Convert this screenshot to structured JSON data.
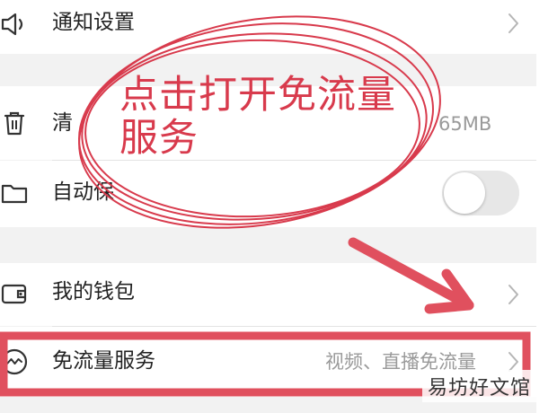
{
  "settings": {
    "notification": {
      "label": "通知设置",
      "icon": "speaker-icon"
    },
    "cache": {
      "label": "清",
      "value": "65MB",
      "icon": "trash-icon"
    },
    "auto_save": {
      "label": "自动保",
      "icon": "folder-icon",
      "toggle_on": false
    },
    "wallet": {
      "label": "我的钱包",
      "icon": "wallet-icon"
    },
    "free_data": {
      "label": "免流量服务",
      "value": "视频、直播免流量",
      "icon": "wave-circle-icon"
    }
  },
  "annotation": {
    "line1": "点击打开免流量",
    "line2": "服务",
    "color": "#d83a4c"
  },
  "watermark": "易坊好文馆"
}
